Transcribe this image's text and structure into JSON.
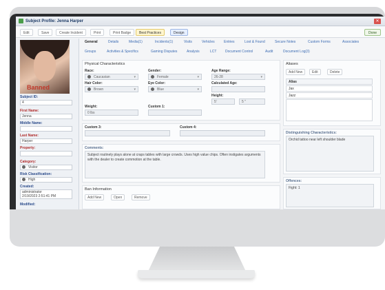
{
  "window": {
    "title": "Subject Profile: Jenna Harper",
    "close_glyph": "✕"
  },
  "toolbar": {
    "edit": "Edit",
    "save": "Save",
    "create_incident": "Create Incident",
    "print": "Print",
    "print_badge": "Print Badge",
    "best_practices": "Best Practices",
    "design": "Design",
    "done": "Done"
  },
  "photo": {
    "overlay": "Banned"
  },
  "left": {
    "subject_id_label": "Subject ID:",
    "subject_id": "4",
    "first_name_label": "First Name:",
    "first_name": "Jenna",
    "middle_name_label": "Middle Name:",
    "middle_name": "",
    "last_name_label": "Last Name:",
    "last_name": "Harper",
    "property_label": "Property:",
    "property": "",
    "category_label": "Category:",
    "category": "Visitor",
    "risk_label": "Risk Classification:",
    "risk": "High",
    "created_label": "Created:",
    "created_by": "administrator",
    "created_at": "2/19/2023 2:51:41 PM",
    "modified_label": "Modified:"
  },
  "tabs": [
    "General",
    "Details",
    "Media(1)",
    "Incidents(1)",
    "Visits",
    "Vehicles",
    "Entries",
    "Lost & Found",
    "Secure Notes",
    "Custom Forms",
    "Associates",
    "Groups",
    "Activities & Specifics",
    "Gaming Disputes",
    "Analysis",
    "LCT",
    "Document Control",
    "Audit",
    "Document Log(3)"
  ],
  "physical": {
    "title": "Physical Characteristics",
    "race_label": "Race:",
    "race": "Caucasian",
    "gender_label": "Gender:",
    "gender": "Female",
    "age_label": "Age Range:",
    "age": "26-28",
    "hair_label": "Hair Color:",
    "hair": "Brown",
    "eye_label": "Eye Color:",
    "eye": "Blue",
    "calc_age_label": "Calculated Age:",
    "calc_age": "",
    "height_label": "Height:",
    "height_ft": "5'",
    "height_in": "5 \"",
    "weight_label": "Weight:",
    "weight": "0 lbs",
    "custom1_label": "Custom 1:"
  },
  "custom": {
    "custom3_label": "Custom 3:",
    "custom4_label": "Custom 4:"
  },
  "comments": {
    "label": "Comments:",
    "text": "Subject routinely plays alone at craps tables with large crowds. Uses high value chips. Often instigates arguments with the dealer to create commotion at the table."
  },
  "ban": {
    "title": "Ban Information",
    "add": "Add New",
    "open": "Open",
    "remove": "Remove"
  },
  "aliases": {
    "title": "Aliases",
    "add": "Add New",
    "edit": "Edit",
    "delete": "Delete",
    "column": "Alias",
    "rows": [
      "Jax",
      "Jazz"
    ]
  },
  "distinguishing": {
    "label": "Distinguishing Characteristics:",
    "text": "Orchid tattoo near left shoulder blade"
  },
  "offences": {
    "label": "Offences:",
    "text": "Fight: 1"
  }
}
